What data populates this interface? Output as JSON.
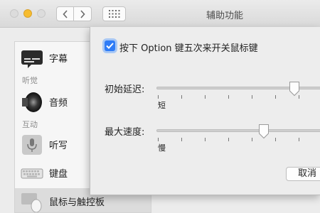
{
  "window": {
    "title": "辅助功能"
  },
  "sidebar": {
    "items": [
      {
        "label": "字幕",
        "icon": "captions-icon"
      },
      {
        "section": "听觉"
      },
      {
        "label": "音频",
        "icon": "speaker-icon"
      },
      {
        "section": "互动"
      },
      {
        "label": "听写",
        "icon": "microphone-icon"
      },
      {
        "label": "键盘",
        "icon": "keyboard-icon"
      },
      {
        "label": "鼠标与触控板",
        "icon": "mouse-icon",
        "selected": true
      }
    ]
  },
  "sheet": {
    "checkbox": {
      "label": "按下 Option 键五次来开关鼠标键",
      "checked": true
    },
    "initial_delay": {
      "label": "初始延迟:",
      "min_label": "短",
      "value": 0.81
    },
    "max_speed": {
      "label": "最大速度:",
      "min_label": "慢",
      "value": 0.63
    },
    "cancel_label": "取消"
  },
  "colors": {
    "accent": "#2f7cf6",
    "minimize": "#f6bc2f"
  }
}
